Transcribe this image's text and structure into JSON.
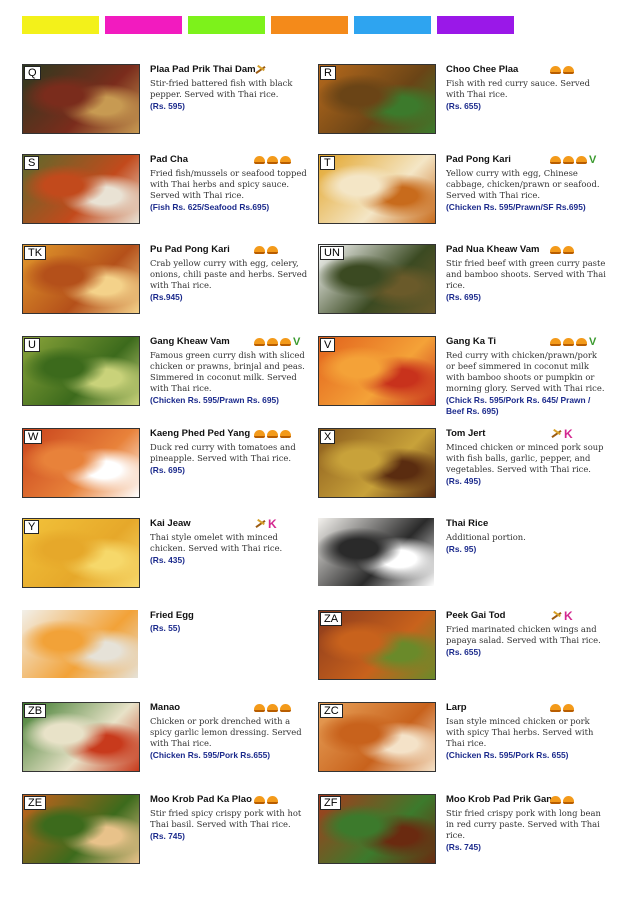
{
  "bar_colors": [
    "#f3f11a",
    "#f21bbf",
    "#7df21b",
    "#f48a1a",
    "#2ea4f0",
    "#9a18e8"
  ],
  "items": [
    {
      "code": "Q",
      "name": "Plaa Pad Prik Thai Dam",
      "desc": "Stir-fried battered fish with black pepper. Served with Thai rice.",
      "price": "(Rs. 595)",
      "icons": [
        "spoon-fork"
      ],
      "photo": [
        "#2c3a1f",
        "#7a2c1c",
        "#c79a52"
      ]
    },
    {
      "code": "R",
      "name": "Choo Chee Plaa",
      "desc": "Fish with red curry sauce. Served with Thai rice.",
      "price": "(Rs. 655)",
      "icons": [
        "chili",
        "chili"
      ],
      "photo": [
        "#b76a1c",
        "#6a4416",
        "#3c7a2c"
      ]
    },
    {
      "code": "S",
      "name": "Pad Cha",
      "desc": "Fried fish/mussels or seafood topped with Thai herbs and spicy sauce. Served with Thai rice.",
      "price": "(Fish Rs. 625/Seafood Rs.695)",
      "icons": [
        "chili",
        "chili",
        "chili"
      ],
      "photo": [
        "#5a6a2c",
        "#c24a1c",
        "#e9e2d4"
      ]
    },
    {
      "code": "T",
      "name": "Pad Pong Kari",
      "desc": "Yellow curry with egg, Chinese cabbage, chicken/prawn or seafood. Served with Thai rice.",
      "price": "(Chicken Rs. 595/Prawn/SF Rs.695)",
      "icons": [
        "chili",
        "chili",
        "chili",
        "veg"
      ],
      "photo": [
        "#e3a52a",
        "#f4e6c6",
        "#c86b1c"
      ]
    },
    {
      "code": "TK",
      "name": "Pu Pad Pong Kari",
      "desc": "Crab yellow curry with egg, celery, onions, chili paste and herbs. Served with Thai rice.",
      "price": "(Rs.945)",
      "icons": [
        "chili",
        "chili"
      ],
      "photo": [
        "#e39a2c",
        "#b4501a",
        "#f4d28a"
      ]
    },
    {
      "code": "UN",
      "name": "Pad Nua Kheaw Vam",
      "desc": "Stir fried beef with green curry paste and bamboo shoots. Served with Thai rice.",
      "price": "(Rs. 695)",
      "icons": [
        "chili",
        "chili"
      ],
      "photo": [
        "#ffffff",
        "#3b4a22",
        "#6a5a2a"
      ]
    },
    {
      "code": "U",
      "name": "Gang Kheaw Vam",
      "desc": "Famous green curry dish with sliced chicken or prawns, brinjal and peas. Simmered in coconut milk. Served with Thai rice.",
      "price": "(Chicken Rs. 595/Prawn Rs. 695)",
      "icons": [
        "chili",
        "chili",
        "chili",
        "veg"
      ],
      "photo": [
        "#8aa43a",
        "#3c6a1c",
        "#c9d27a"
      ]
    },
    {
      "code": "V",
      "name": "Gang Ka Ti",
      "desc": "Red curry with chicken/prawn/pork or beef simmered in coconut milk with bamboo shoots or pumpkin or morning glory. Served with Thai rice.",
      "price": "(Chick Rs. 595/Pork Rs. 645/ Prawn / Beef Rs. 695)",
      "icons": [
        "chili",
        "chili",
        "chili",
        "veg"
      ],
      "photo": [
        "#e2621c",
        "#f4a238",
        "#c8321c"
      ]
    },
    {
      "code": "W",
      "name": "Kaeng Phed Ped Yang",
      "desc": "Duck red curry with tomatoes and pineapple. Served with Thai rice.",
      "price": "(Rs. 695)",
      "icons": [
        "chili",
        "chili",
        "chili"
      ],
      "photo": [
        "#c8421c",
        "#e8823a",
        "#ffffff"
      ]
    },
    {
      "code": "X",
      "name": "Tom Jert",
      "desc": "Minced chicken or minced pork soup with fish balls, garlic, pepper, and vegetables. Served with Thai rice.",
      "price": "(Rs. 495)",
      "icons": [
        "spoon-fork",
        "kid"
      ],
      "photo": [
        "#8a5a1c",
        "#c8a23a",
        "#5a2c10"
      ]
    },
    {
      "code": "Y",
      "name": "Kai Jeaw",
      "desc": "Thai style omelet with minced chicken. Served with Thai rice.",
      "price": "(Rs. 435)",
      "icons": [
        "spoon-fork",
        "kid"
      ],
      "photo": [
        "#f2c23a",
        "#e6a82a",
        "#f6d86a"
      ]
    },
    {
      "code": "",
      "name": "Thai Rice",
      "desc": "Additional portion.",
      "price": "(Rs. 95)",
      "icons": [],
      "photo": [
        "#f4f2ee",
        "#2a2a2a",
        "#ffffff"
      ]
    },
    {
      "code": "",
      "name": "Fried Egg",
      "desc": "",
      "price": "(Rs. 55)",
      "icons": [],
      "photo": [
        "#f2f0ea",
        "#f2a238",
        "#e6e2d8"
      ]
    },
    {
      "code": "ZA",
      "name": "Peek Gai Tod",
      "desc": "Fried marinated chicken wings and papaya salad. Served with Thai rice.",
      "price": "(Rs. 655)",
      "icons": [
        "spoon-fork",
        "kid"
      ],
      "photo": [
        "#8a3a1c",
        "#c8621c",
        "#6a8a2a"
      ]
    },
    {
      "code": "ZB",
      "name": "Manao",
      "desc": "Chicken or pork drenched with a spicy garlic lemon dressing. Served with Thai rice.",
      "price": "(Chicken Rs. 595/Pork Rs.655)",
      "icons": [
        "chili",
        "chili",
        "chili"
      ],
      "photo": [
        "#3c7a2c",
        "#e8e2c8",
        "#c83a1c"
      ]
    },
    {
      "code": "ZC",
      "name": "Larp",
      "desc": "Isan style minced chicken or pork with spicy Thai herbs. Served with Thai rice.",
      "price": "(Chicken Rs. 595/Pork Rs. 655)",
      "icons": [
        "chili",
        "chili"
      ],
      "photo": [
        "#e8a25a",
        "#c8621c",
        "#f4e2c8"
      ]
    },
    {
      "code": "ZE",
      "name": "Moo Krob Pad Ka Plao",
      "desc": "Stir fried spicy crispy pork with hot Thai basil. Served with Thai rice.",
      "price": "(Rs. 745)",
      "icons": [
        "chili",
        "chili"
      ],
      "photo": [
        "#c8621c",
        "#3c6a1c",
        "#e8c28a"
      ]
    },
    {
      "code": "ZF",
      "name": "Moo Krob Pad Prik Gang",
      "desc": "Stir fried crispy pork with long bean in red curry paste. Served with Thai rice.",
      "price": "(Rs. 745)",
      "icons": [
        "chili",
        "chili"
      ],
      "photo": [
        "#a83a1c",
        "#3c7a2c",
        "#6a2a10"
      ]
    }
  ]
}
